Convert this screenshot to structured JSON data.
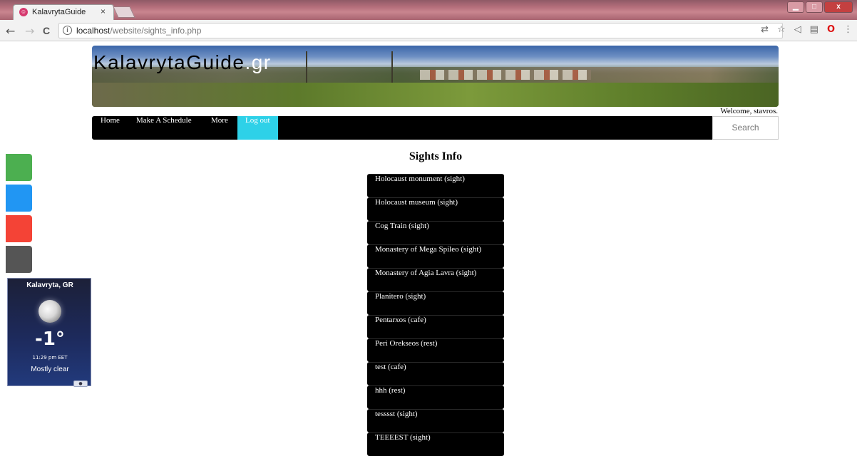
{
  "browser": {
    "tab_title": "KalavrytaGuide",
    "tab_close": "×",
    "url_host": "localhost",
    "url_path": "/website/sights_info.php",
    "info_glyph": "i",
    "back_glyph": "←",
    "forward_glyph": "→",
    "reload_glyph": "C",
    "toolbar_icons": [
      "translate-icon",
      "star-icon",
      "pocket-icon",
      "reader-icon",
      "opera-icon",
      "menu-icon"
    ],
    "min_glyph": "▁",
    "max_glyph": "□",
    "close_glyph": "x"
  },
  "site": {
    "logo_text": "KalavrytaGuide",
    "logo_dot": ".",
    "logo_tld": "gr",
    "welcome": "Welcome, stavros."
  },
  "nav": {
    "home": "Home",
    "schedule": "Make A Schedule",
    "more": "More",
    "logout": "Log out",
    "search_placeholder": "Search"
  },
  "weather": {
    "location": "Kalavryta, GR",
    "temperature": "-1°",
    "time": "11:29 pm EET",
    "condition": "Mostly clear"
  },
  "colors": {
    "logout_bg": "#2ed1e8",
    "share_green": "#4caf50",
    "share_blue": "#2196f3",
    "share_red": "#f44336",
    "share_grey": "#555555"
  },
  "sights": {
    "title": "Sights Info",
    "items": [
      "Holocaust monument (sight)",
      "Holocaust museum (sight)",
      "Cog Train (sight)",
      "Monastery of Mega Spileo (sight)",
      "Monastery of Agia Lavra (sight)",
      "Planitero (sight)",
      "Pentarxos (cafe)",
      "Peri Orekseos (rest)",
      "test (cafe)",
      "hhh (rest)",
      "tesssst (sight)",
      "TEEEEST (sight)"
    ]
  }
}
